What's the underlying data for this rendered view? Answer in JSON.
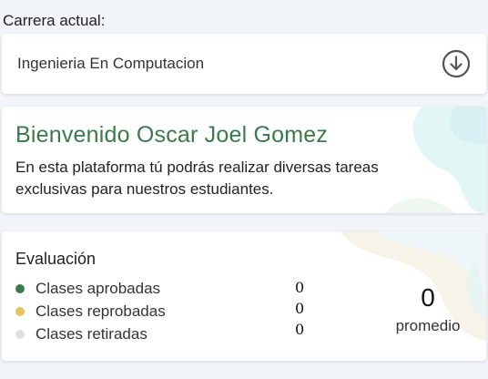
{
  "career": {
    "label": "Carrera actual:",
    "selected": "Ingenieria En Computacion",
    "icon": "download-circle-icon"
  },
  "welcome": {
    "title": "Bienvenido Oscar Joel Gomez",
    "description": "En esta plataforma tú podrás realizar diversas tareas exclusivas para nuestros estudiantes."
  },
  "evaluation": {
    "title": "Evaluación",
    "items": [
      {
        "label": "Clases aprobadas",
        "count": "0",
        "color": "#3b7a4a"
      },
      {
        "label": "Clases reprobadas",
        "count": "0",
        "color": "#e8c35a"
      },
      {
        "label": "Clases retiradas",
        "count": "0",
        "color": "#e0e0e0"
      }
    ],
    "average": {
      "value": "0",
      "label": "promedio"
    }
  },
  "colors": {
    "background": "#f1f4f8",
    "title_green": "#3b7a4a"
  }
}
